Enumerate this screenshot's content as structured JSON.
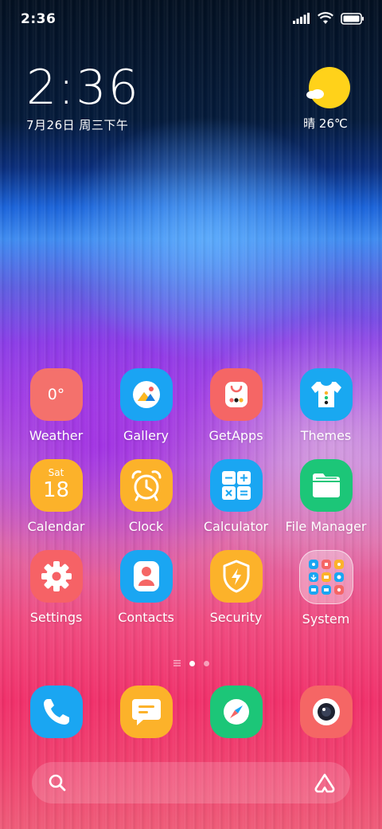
{
  "status_bar": {
    "time": "2:36",
    "icons": [
      "signal-icon",
      "wifi-icon",
      "battery-icon"
    ]
  },
  "clock_widget": {
    "time": "2:36",
    "date": "7月26日 周三下午"
  },
  "weather_widget": {
    "text": "晴 26℃",
    "icon": "sunny-cloud-icon"
  },
  "apps": [
    {
      "label": "Weather",
      "icon": "weather-icon",
      "color": "#f4716c",
      "badge_text": "0°"
    },
    {
      "label": "Gallery",
      "icon": "gallery-icon",
      "color": "#1aa4f3"
    },
    {
      "label": "GetApps",
      "icon": "shopping-bag-icon",
      "color": "#f56665"
    },
    {
      "label": "Themes",
      "icon": "tshirt-icon",
      "color": "#19a8f1"
    },
    {
      "label": "Calendar",
      "icon": "calendar-icon",
      "color": "#fcb22a",
      "day_text": "Sat",
      "date_text": "18"
    },
    {
      "label": "Clock",
      "icon": "alarm-clock-icon",
      "color": "#fcb22a"
    },
    {
      "label": "Calculator",
      "icon": "calculator-icon",
      "color": "#1aa6f2"
    },
    {
      "label": "File Manager",
      "icon": "folder-icon",
      "color": "#1cc678"
    },
    {
      "label": "Settings",
      "icon": "gear-icon",
      "color": "#f66266"
    },
    {
      "label": "Contacts",
      "icon": "contacts-icon",
      "color": "#1aa6f2"
    },
    {
      "label": "Security",
      "icon": "shield-icon",
      "color": "#fcb22a"
    },
    {
      "label": "System",
      "icon": "folder-grid-icon",
      "color": "rgba(255,255,255,0.35)"
    }
  ],
  "page_indicator": {
    "pages": 2,
    "active": 1
  },
  "dock": [
    {
      "name": "phone",
      "icon": "phone-icon",
      "color": "#1aa6f2"
    },
    {
      "name": "messages",
      "icon": "message-icon",
      "color": "#fcb22a"
    },
    {
      "name": "browser",
      "icon": "compass-icon",
      "color": "#1cc678"
    },
    {
      "name": "camera",
      "icon": "camera-icon",
      "color": "#f56665"
    }
  ],
  "search_bar": {
    "icons": [
      "search-icon",
      "assistant-icon"
    ]
  }
}
